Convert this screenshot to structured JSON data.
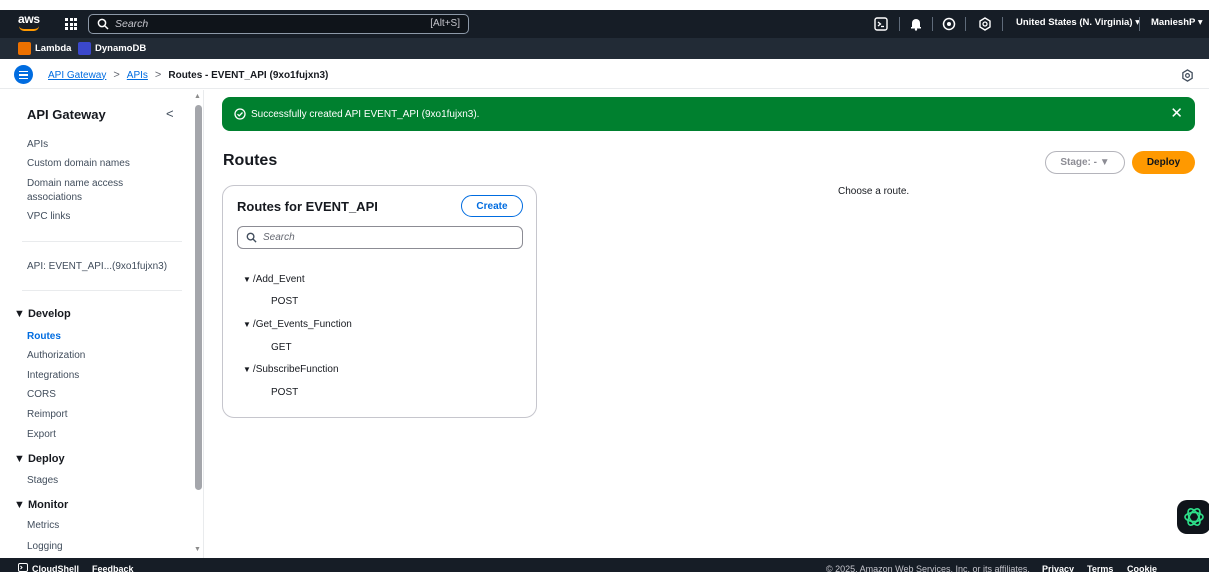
{
  "topbar": {
    "logo": "aws",
    "search_placeholder": "Search",
    "search_shortcut": "[Alt+S]",
    "region": "United States (N. Virginia) ▾",
    "user": "ManieshP ▾"
  },
  "favorites": [
    {
      "label": "Lambda",
      "color": "#ed7100"
    },
    {
      "label": "DynamoDB",
      "color": "#3b48cc"
    }
  ],
  "breadcrumb": {
    "items": [
      "API Gateway",
      "APIs"
    ],
    "current": "Routes - EVENT_API (9xo1fujxn3)"
  },
  "sidebar": {
    "title": "API Gateway",
    "top_items": [
      "APIs",
      "Custom domain names",
      "Domain name access",
      "associations",
      "VPC links"
    ],
    "api_label": "API: EVENT_API...(9xo1fujxn3)",
    "develop": {
      "label": "▼ Develop",
      "items": [
        "Routes",
        "Authorization",
        "Integrations",
        "CORS",
        "Reimport",
        "Export"
      ]
    },
    "deploy": {
      "label": "▼ Deploy",
      "items": [
        "Stages"
      ]
    },
    "monitor": {
      "label": "▼ Monitor",
      "items": [
        "Metrics",
        "Logging"
      ]
    }
  },
  "flash": {
    "message": "Successfully created API EVENT_API (9xo1fujxn3).",
    "close": "✕",
    "color": "#00802f"
  },
  "main": {
    "title": "Routes",
    "stage_label": "Stage: -  ▼",
    "deploy_label": "Deploy",
    "empty_text": "Choose a route."
  },
  "routes_panel": {
    "title": "Routes for EVENT_API",
    "create_label": "Create",
    "search_placeholder": "Search",
    "routes": [
      {
        "path": "/Add_Event",
        "method": "POST"
      },
      {
        "path": "/Get_Events_Function",
        "method": "GET"
      },
      {
        "path": "/SubscribeFunction",
        "method": "POST"
      }
    ]
  },
  "footer": {
    "cloudshell": "CloudShell",
    "feedback": "Feedback",
    "copyright": "© 2025, Amazon Web Services, Inc. or its affiliates.",
    "privacy": "Privacy",
    "terms": "Terms",
    "cookies": "Cookie preferences"
  },
  "colors": {
    "accent": "#006ce0",
    "deploy": "#ff9900",
    "topbar": "#161d26"
  }
}
